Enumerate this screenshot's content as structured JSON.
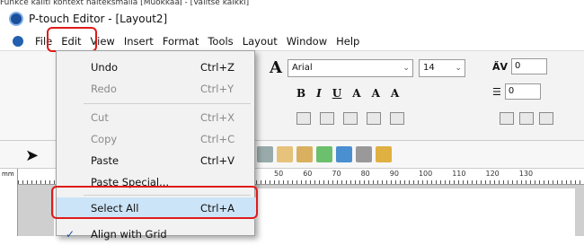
{
  "caption": "Funkce kaliti kontext naiteksmalla [MuokkaaJ - [Valitse kaikki]",
  "window": {
    "title": "P-touch Editor - [Layout2]"
  },
  "menubar": {
    "items": [
      "File",
      "Edit",
      "View",
      "Insert",
      "Format",
      "Tools",
      "Layout",
      "Window",
      "Help"
    ]
  },
  "font": {
    "name": "Arial",
    "size": "14"
  },
  "spinners": {
    "spacing": "0",
    "line": "0"
  },
  "format_buttons": [
    "B",
    "I",
    "U",
    "A",
    "A",
    "A"
  ],
  "ruler": {
    "unit": "mm",
    "ticks": [
      "50",
      "60",
      "70",
      "80",
      "90",
      "100",
      "110",
      "120",
      "130"
    ]
  },
  "edit_menu": {
    "items": [
      {
        "label": "Undo",
        "shortcut": "Ctrl+Z",
        "enabled": true
      },
      {
        "label": "Redo",
        "shortcut": "Ctrl+Y",
        "enabled": false
      },
      {
        "label": "Cut",
        "shortcut": "Ctrl+X",
        "enabled": false
      },
      {
        "label": "Copy",
        "shortcut": "Ctrl+C",
        "enabled": false
      },
      {
        "label": "Paste",
        "shortcut": "Ctrl+V",
        "enabled": true
      },
      {
        "label": "Paste Special...",
        "shortcut": "",
        "enabled": true
      },
      {
        "label": "Select All",
        "shortcut": "Ctrl+A",
        "enabled": true,
        "selected": true
      },
      {
        "label": "Align with Grid",
        "shortcut": "",
        "enabled": true,
        "checked": true
      }
    ]
  },
  "colors": {
    "highlight_border": "#e01a1a",
    "selected_bg": "#cce4f7"
  }
}
